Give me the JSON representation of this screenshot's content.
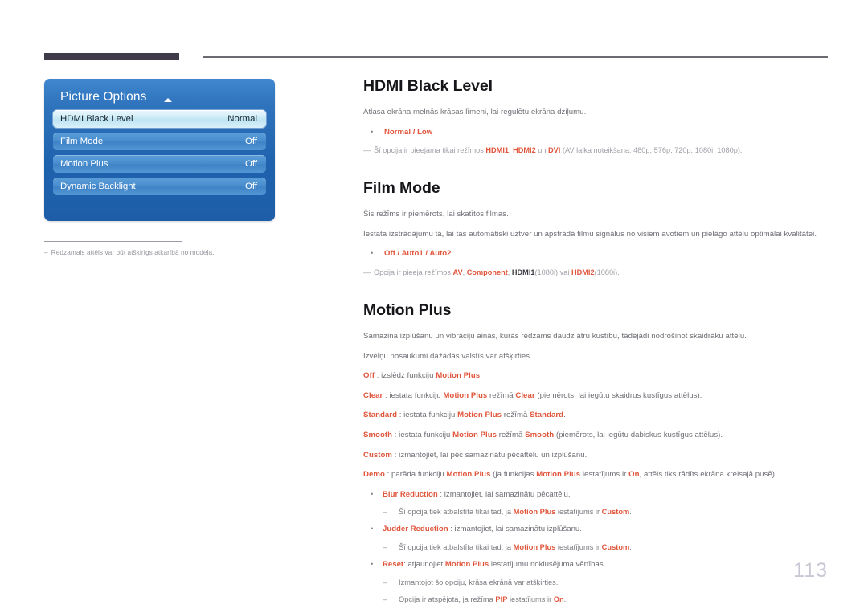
{
  "page_number": "113",
  "osd_menu": {
    "title": "Picture Options",
    "caret_icon": "caret-up-icon",
    "rows": [
      {
        "label": "HDMI Black Level",
        "value": "Normal",
        "selected": true
      },
      {
        "label": "Film Mode",
        "value": "Off",
        "selected": false
      },
      {
        "label": "Motion Plus",
        "value": "Off",
        "selected": false
      },
      {
        "label": "Dynamic Backlight",
        "value": "Off",
        "selected": false
      }
    ],
    "footnote_dash": "–",
    "footnote": "Redzamais attēls var būt atšķirīgs atkarībā no modeļa."
  },
  "bullet_glyph": "•",
  "emdash_glyph": "—",
  "subdash_glyph": "–",
  "sections": {
    "hdmi_black_level": {
      "heading": "HDMI Black Level",
      "intro": "Atlasa ekrāna melnās krāsas līmeni, lai regulētu ekrāna dziļumu.",
      "options": {
        "a": "Normal",
        "sep": " / ",
        "b": "Low"
      },
      "note": {
        "pre": "Šī opcija ir pieejama tikai režīmos ",
        "k1": "HDMI1",
        "s1": ", ",
        "k2": "HDMI2",
        "s2": " un ",
        "k3": "DVI",
        "post": " (AV laika noteikšana: 480p, 576p, 720p, 1080i, 1080p)."
      }
    },
    "film_mode": {
      "heading": "Film Mode",
      "p1": "Šis režīms ir piemērots, lai skatītos filmas.",
      "p2": "Iestata izstrādājumu tā, lai tas automātiski uztver un apstrādā filmu signālus no visiem avotiem un pielāgo attēlu optimālai kvalitātei.",
      "options": {
        "a": "Off",
        "s1": " / ",
        "b": "Auto1",
        "s2": " / ",
        "c": "Auto2"
      },
      "note": {
        "pre": "Opcija ir pieeja režīmos ",
        "k1": "AV",
        "s1": ", ",
        "k2": "Component",
        "s2": ", ",
        "k3": "HDMI1",
        "t3": "(1080i)",
        "s3": " vai ",
        "k4": "HDMI2",
        "t4": "(1080i).",
        "post": ""
      }
    },
    "motion_plus": {
      "heading": "Motion Plus",
      "p1": "Samazina izplūšanu un vibrāciju ainās, kurās redzams daudz ātru kustību, tādējādi nodrošinot skaidrāku attēlu.",
      "p2": "Izvēlņu nosaukumi dažādās valstīs var atšķirties.",
      "lines": [
        {
          "key": "Off",
          "mid": " : izslēdz funkciju ",
          "bold": "Motion Plus",
          "tail": "."
        },
        {
          "key": "Clear",
          "mid": " : iestata funkciju ",
          "bold": "Motion Plus",
          "mid2": " režīmā ",
          "bold2": "Clear",
          "tail": " (piemērots, lai iegūtu skaidrus kustīgus attēlus)."
        },
        {
          "key": "Standard",
          "mid": " : iestata funkciju ",
          "bold": "Motion Plus",
          "mid2": " režīmā ",
          "bold2": "Standard",
          "tail": "."
        },
        {
          "key": "Smooth",
          "mid": " : iestata funkciju ",
          "bold": "Motion Plus",
          "mid2": "  režīmā ",
          "bold2": "Smooth",
          "tail": " (piemērots, lai iegūtu dabiskus kustīgus attēlus)."
        },
        {
          "key": "Custom",
          "mid": " : izmantojiet, lai pēc samazinātu pēcattēlu un izplūšanu.",
          "bold": "",
          "tail": ""
        },
        {
          "key": "Demo",
          "mid": " : parāda funkciju ",
          "bold": "Motion Plus",
          "mid2": " (ja funkcijas ",
          "bold2": "Motion Plus",
          "mid3": " iestatījums ir ",
          "bold3": "On",
          "tail": ", attēls tiks rādīts ekrāna kreisajā pusē)."
        }
      ],
      "sub_items": [
        {
          "key": "Blur Reduction",
          "text": " : izmantojiet, lai samazinātu pēcattēlu.",
          "notes": [
            {
              "pre": "Šī opcija tiek atbalstīta tikai tad, ja ",
              "k1": "Motion Plus",
              "mid": " iestatījums ir ",
              "k2": "Custom",
              "post": "."
            }
          ]
        },
        {
          "key": "Judder Reduction",
          "text": " : izmantojiet, lai samazinātu izplūšanu.",
          "notes": [
            {
              "pre": "Šī opcija tiek atbalstīta tikai tad, ja ",
              "k1": "Motion Plus",
              "mid": " iestatījums ir ",
              "k2": "Custom",
              "post": "."
            }
          ]
        },
        {
          "key": "Reset",
          "text": ": atjaunojiet ",
          "bold": "Motion Plus",
          "text2": " iestatījumu noklusējuma vērtības.",
          "notes": [
            {
              "pre": "Izmantojot šo opciju, krāsa ekrānā var atšķirties.",
              "k1": "",
              "mid": "",
              "k2": "",
              "post": ""
            },
            {
              "pre": "Opcija ir atspējota, ja režīma ",
              "k1": "PIP",
              "mid": " iestatījums ir ",
              "k2": "On",
              "post": "."
            }
          ]
        }
      ]
    }
  }
}
